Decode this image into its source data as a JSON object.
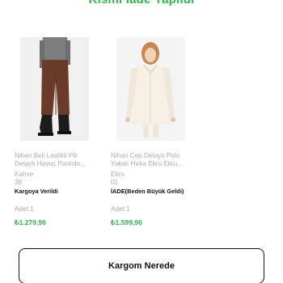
{
  "header": {
    "title": "Kısmi İade Yapıldı"
  },
  "products": [
    {
      "name": "Nihan Beli Lastikli Pili Detaylı Havuç Pantolo...",
      "color": "Kahve",
      "size": "38",
      "status": "Kargoya Verildi",
      "quantity": "Adet:1",
      "price": "₺1.279,96",
      "image_icon": "brown-trousers-image"
    },
    {
      "name": "Nihan Cep Detaylı Polo Yakalı Hırka  Ekru Ekru...",
      "color": "Ekru",
      "size": "01",
      "status": "İADE(Beden Büyük Geldi)",
      "quantity": "Adet:1",
      "price": "₺1.599,96",
      "image_icon": "cream-cardigan-image"
    }
  ],
  "actions": {
    "track_label": "Kargom Nerede"
  },
  "colors": {
    "accent": "#2eb84a",
    "text": "#111111",
    "muted": "#a9a9a9"
  }
}
